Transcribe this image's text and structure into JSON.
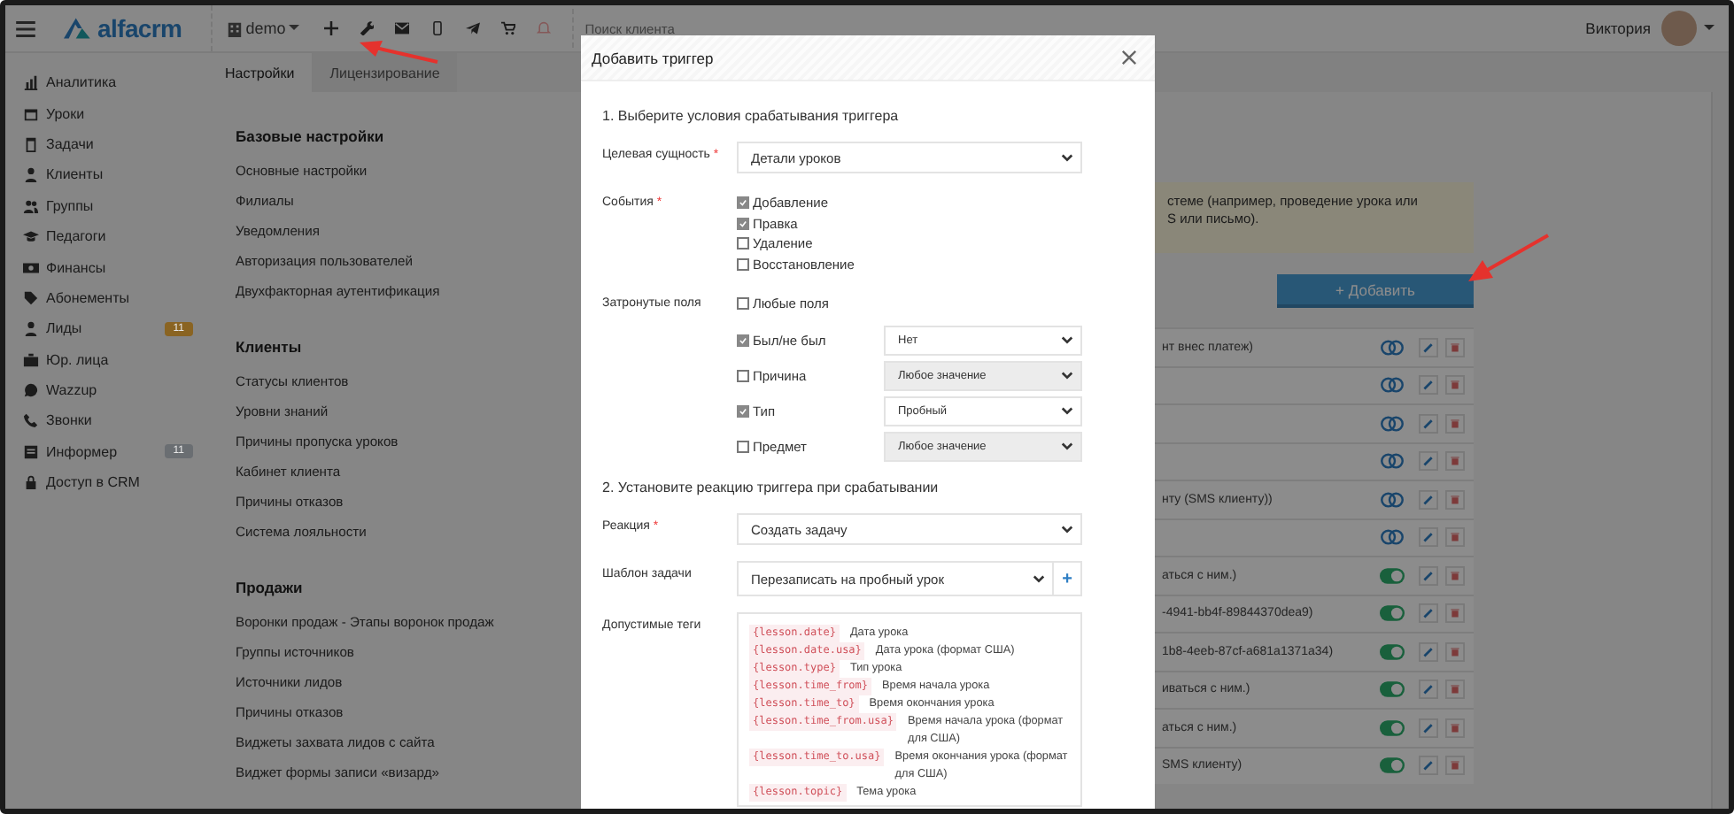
{
  "topbar": {
    "logo": "alfacrm",
    "branch": "demo",
    "search_placeholder": "Поиск клиента",
    "user": "Виктория"
  },
  "sidebar": {
    "items": [
      {
        "label": "Аналитика"
      },
      {
        "label": "Уроки"
      },
      {
        "label": "Задачи"
      },
      {
        "label": "Клиенты"
      },
      {
        "label": "Группы"
      },
      {
        "label": "Педагоги"
      },
      {
        "label": "Финансы"
      },
      {
        "label": "Абонементы"
      },
      {
        "label": "Лиды",
        "badge": {
          "text": "11",
          "color": "#8a6422"
        }
      },
      {
        "label": "Юр. лица"
      },
      {
        "label": "Wazzup"
      },
      {
        "label": "Звонки"
      },
      {
        "label": "Информер",
        "badge": {
          "text": "11",
          "color": "#6a6e72"
        }
      },
      {
        "label": "Доступ в CRM"
      }
    ]
  },
  "tabs": [
    {
      "label": "Настройки",
      "selected": true
    },
    {
      "label": "Лицензирование",
      "selected": false
    }
  ],
  "settings": [
    {
      "heading": "Базовые настройки",
      "links": [
        "Основные настройки",
        "Филиалы",
        "Уведомления",
        "Авторизация пользователей",
        "Двухфакторная аутентификация"
      ]
    },
    {
      "heading": "Клиенты",
      "links": [
        "Статусы клиентов",
        "Уровни знаний",
        "Причины пропуска уроков",
        "Кабинет клиента",
        "Причины отказов",
        "Система лояльности"
      ]
    },
    {
      "heading": "Продажи",
      "links": [
        "Воронки продаж - Этапы воронок продаж",
        "Группы источников",
        "Источники лидов",
        "Причины отказов",
        "Виджеты захвата лидов с сайта",
        "Виджет формы записи «визард»"
      ]
    }
  ],
  "triggers": {
    "notice_lines": [
      "стеме (например, проведение урока или",
      "S или письмо)."
    ],
    "add_button": "+ Добавить",
    "rows": [
      {
        "text": "нт внес платеж)",
        "enabled": false
      },
      {
        "enabled": false
      },
      {
        "enabled": false
      },
      {
        "enabled": false
      },
      {
        "text": "нту (SMS клиенту))",
        "enabled": false
      },
      {
        "enabled": false
      },
      {
        "text": "аться с ним.)",
        "enabled": true
      },
      {
        "text": "-4941-bb4f-89844370dea9)",
        "enabled": true
      },
      {
        "text": "1b8-4eeb-87cf-a681a1371a34)",
        "enabled": true
      },
      {
        "text": "иваться с ним.)",
        "enabled": true
      },
      {
        "text": "аться с ним.)",
        "enabled": true
      },
      {
        "text": "SMS клиенту)",
        "enabled": true
      }
    ]
  },
  "modal": {
    "title": "Добавить триггер",
    "section_1": "1. Выберите условия срабатывания триггера",
    "target": {
      "label": "Целевая сущность",
      "required_mark": "*",
      "value": "Детали уроков"
    },
    "events": {
      "label": "События",
      "required_mark": "*",
      "options": [
        {
          "label": "Добавление",
          "checked": true
        },
        {
          "label": "Правка",
          "checked": true
        },
        {
          "label": "Удаление",
          "checked": false
        },
        {
          "label": "Восстановление",
          "checked": false
        }
      ]
    },
    "affected": {
      "label": "Затронутые поля",
      "any": {
        "label": "Любые поля",
        "checked": false
      },
      "fields": [
        {
          "label": "Был/не был",
          "checked": true,
          "value": "Нет"
        },
        {
          "label": "Причина",
          "checked": false,
          "value": "Любое значение"
        },
        {
          "label": "Тип",
          "checked": true,
          "value": "Пробный"
        },
        {
          "label": "Предмет",
          "checked": false,
          "value": "Любое значение"
        }
      ]
    },
    "section_2": "2. Установите реакцию триггера при срабатывании",
    "reaction": {
      "label": "Реакция",
      "required_mark": "*",
      "value": "Создать задачу"
    },
    "template": {
      "label": "Шаблон задачи",
      "value": "Перезаписать на пробный урок",
      "add": "+"
    },
    "tags": {
      "label": "Допустимые теги",
      "items": [
        {
          "code": "{lesson.date}",
          "description": "Дата урока"
        },
        {
          "code": "{lesson.date.usa}",
          "description": "Дата урока (формат США)"
        },
        {
          "code": "{lesson.type}",
          "description": "Тип урока"
        },
        {
          "code": "{lesson.time_from}",
          "description": "Время начала урока"
        },
        {
          "code": "{lesson.time_to}",
          "description": "Время окончания урока"
        },
        {
          "code": "{lesson.time_from.usa}",
          "description": "Время начала урока (формат для США)"
        },
        {
          "code": "{lesson.time_to.usa}",
          "description": "Время окончания урока (формат для США)"
        },
        {
          "code": "{lesson.topic}",
          "description": "Тема урока"
        }
      ]
    }
  }
}
